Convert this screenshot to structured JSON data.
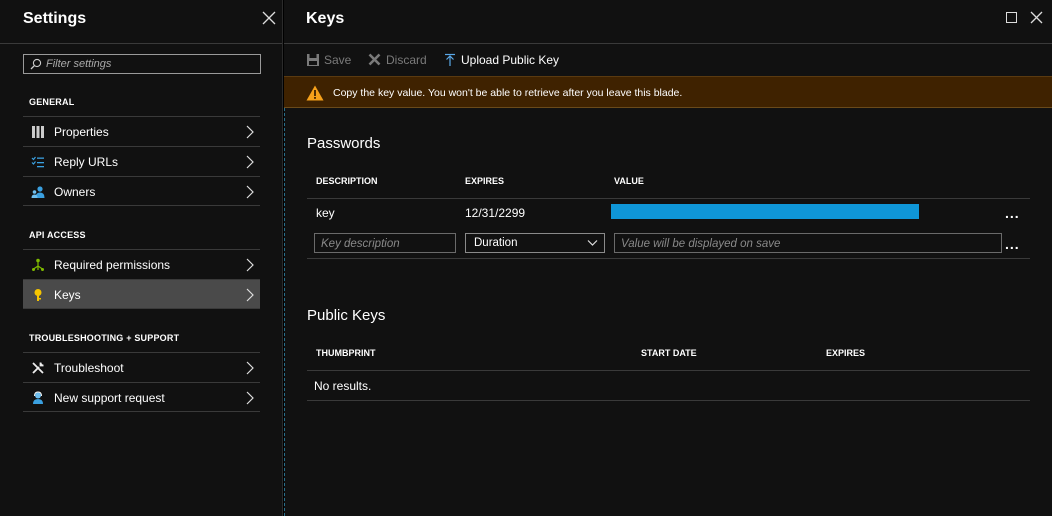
{
  "settings": {
    "title": "Settings",
    "filter_placeholder": "Filter settings",
    "sections": [
      {
        "label": "GENERAL",
        "items": [
          {
            "label": "Properties",
            "icon": "properties-icon"
          },
          {
            "label": "Reply URLs",
            "icon": "reply-urls-icon"
          },
          {
            "label": "Owners",
            "icon": "owners-icon"
          }
        ]
      },
      {
        "label": "API ACCESS",
        "items": [
          {
            "label": "Required permissions",
            "icon": "permissions-icon"
          },
          {
            "label": "Keys",
            "icon": "key-icon",
            "selected": true
          }
        ]
      },
      {
        "label": "TROUBLESHOOTING + SUPPORT",
        "items": [
          {
            "label": "Troubleshoot",
            "icon": "wrench-icon"
          },
          {
            "label": "New support request",
            "icon": "support-icon"
          }
        ]
      }
    ]
  },
  "keys": {
    "title": "Keys",
    "toolbar": {
      "save_label": "Save",
      "discard_label": "Discard",
      "upload_label": "Upload Public Key"
    },
    "warning": "Copy the key value. You won't be able to retrieve after you leave this blade.",
    "passwords": {
      "title": "Passwords",
      "columns": [
        "DESCRIPTION",
        "EXPIRES",
        "VALUE"
      ],
      "rows": [
        {
          "description": "key",
          "expires": "12/31/2299"
        }
      ],
      "new_row": {
        "description_placeholder": "Key description",
        "duration_value": "Duration",
        "value_placeholder": "Value will be displayed on save"
      },
      "more_label": "..."
    },
    "public_keys": {
      "title": "Public Keys",
      "columns": [
        "THUMBPRINT",
        "START DATE",
        "EXPIRES"
      ],
      "empty_text": "No results."
    }
  },
  "colors": {
    "accent": "#0f96d8",
    "warning_bg": "#3f2200",
    "warning_icon": "#f7a11a",
    "selected_item_bg": "#4a4a4a",
    "key_icon": "#f5c400",
    "permissions_icon": "#7fba00"
  }
}
